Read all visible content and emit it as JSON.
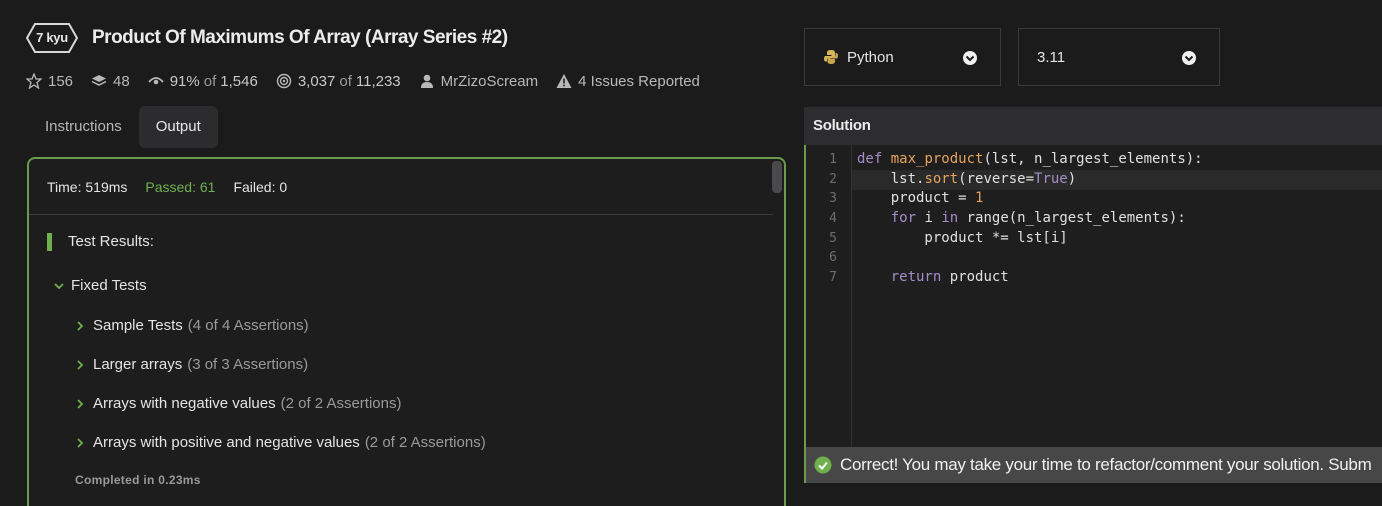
{
  "kata": {
    "rank": "7 kyu",
    "title": "Product Of Maximums Of Array (Array Series #2)"
  },
  "stats": {
    "stars": "156",
    "collections": "48",
    "satisfaction": "91%",
    "satisfaction_of": "of",
    "satisfaction_total": "1,546",
    "completed": "3,037",
    "completed_of": "of",
    "completed_total": "11,233",
    "author": "MrZizoScream",
    "issues": "4 Issues Reported"
  },
  "tabs": [
    {
      "label": "Instructions",
      "active": false
    },
    {
      "label": "Output",
      "active": true
    }
  ],
  "output": {
    "time": "Time: 519ms",
    "passed": "Passed: 61",
    "failed": "Failed: 0",
    "results_heading": "Test Results:",
    "group": "Fixed Tests",
    "tests": [
      {
        "name": "Sample Tests",
        "count": "(4 of 4 Assertions)"
      },
      {
        "name": "Larger arrays",
        "count": "(3 of 3 Assertions)"
      },
      {
        "name": "Arrays with negative values",
        "count": "(2 of 2 Assertions)"
      },
      {
        "name": "Arrays with positive and negative values",
        "count": "(2 of 2 Assertions)"
      }
    ],
    "completed": "Completed in 0.23ms"
  },
  "language_select": {
    "value": "Python"
  },
  "version_select": {
    "value": "3.11"
  },
  "solution": {
    "header": "Solution",
    "line_numbers": [
      "1",
      "2",
      "3",
      "4",
      "5",
      "6",
      "7"
    ],
    "code": {
      "l1_def": "def",
      "l1_fn": "max_product",
      "l1_rest": "(lst, n_largest_elements):",
      "l2_a": "    lst.",
      "l2_sort": "sort",
      "l2_b": "(reverse=",
      "l2_true": "True",
      "l2_c": ")",
      "l3_a": "    product = ",
      "l3_num": "1",
      "l4_for": "    for",
      "l4_mid": " i ",
      "l4_in": "in",
      "l4_rest": " range(n_largest_elements):",
      "l5": "        product *= lst[i]",
      "l7_return": "    return",
      "l7_rest": " product"
    }
  },
  "status": {
    "message": "Correct! You may take your time to refactor/comment your solution. Subm"
  },
  "colors": {
    "accent_green": "#6fb04e",
    "border_green": "#6a9c4b",
    "keyword": "#a38ec9",
    "function": "#e7a35c"
  },
  "icons": [
    "star-icon",
    "layers-icon",
    "eye-icon",
    "target-icon",
    "user-icon",
    "warning-icon",
    "chevron-right-icon",
    "chevron-down-icon",
    "python-icon",
    "check-circle-icon"
  ]
}
